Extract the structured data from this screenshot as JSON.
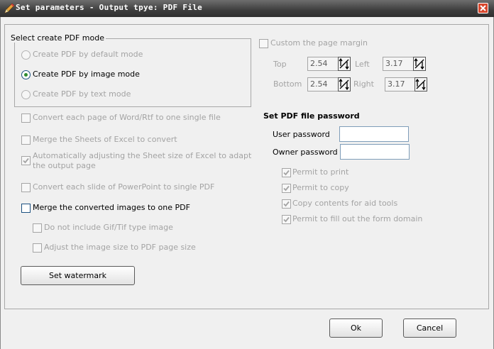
{
  "window": {
    "title": "Set parameters - Output tpye: PDF File"
  },
  "mode_group": {
    "legend": "Select create PDF mode",
    "options": [
      {
        "label": "Create PDF by default mode",
        "selected": false,
        "enabled": false
      },
      {
        "label": "Create PDF by image mode",
        "selected": true,
        "enabled": true
      },
      {
        "label": "Create PDF by text mode",
        "selected": false,
        "enabled": false
      }
    ]
  },
  "left_options": {
    "word_single": "Convert each page of Word/Rtf to one single file",
    "merge_excel": "Merge the Sheets of Excel to convert",
    "auto_adjust_line1": "Automatically adjusting the Sheet size of Excel to adapt",
    "auto_adjust_line2": "the output page",
    "ppt_single": "Convert each slide of PowerPoint to single PDF",
    "merge_images": "Merge the converted images to one PDF",
    "no_gif_tif": "Do not include Gif/Tif type image",
    "adjust_image_size": "Adjust the image size to PDF page size",
    "auto_adjust_checked": true
  },
  "watermark_button": "Set watermark",
  "margin": {
    "custom_label": "Custom the page margin",
    "top_label": "Top",
    "top_value": "2.54",
    "left_label": "Left",
    "left_value": "3.17",
    "bottom_label": "Bottom",
    "bottom_value": "2.54",
    "right_label": "Right",
    "right_value": "3.17"
  },
  "password": {
    "heading": "Set PDF file password",
    "user_label": "User password",
    "user_value": "",
    "owner_label": "Owner password",
    "owner_value": "",
    "permissions": [
      {
        "label": "Permit to print",
        "checked": true
      },
      {
        "label": "Permit to copy",
        "checked": true
      },
      {
        "label": "Copy contents for aid tools",
        "checked": true
      },
      {
        "label": "Permit to fill out the form domain",
        "checked": true
      }
    ]
  },
  "buttons": {
    "ok": "Ok",
    "cancel": "Cancel"
  },
  "colors": {
    "titlebar": "#3d3d3d",
    "close_button": "#d7462c",
    "radio_selected": "#2e8b2e",
    "disabled_text": "#a3a3a3"
  },
  "icons": {
    "app": "pencil-icon",
    "close": "close-icon",
    "spin": "spin-arrows-icon",
    "check": "checkmark-icon"
  }
}
